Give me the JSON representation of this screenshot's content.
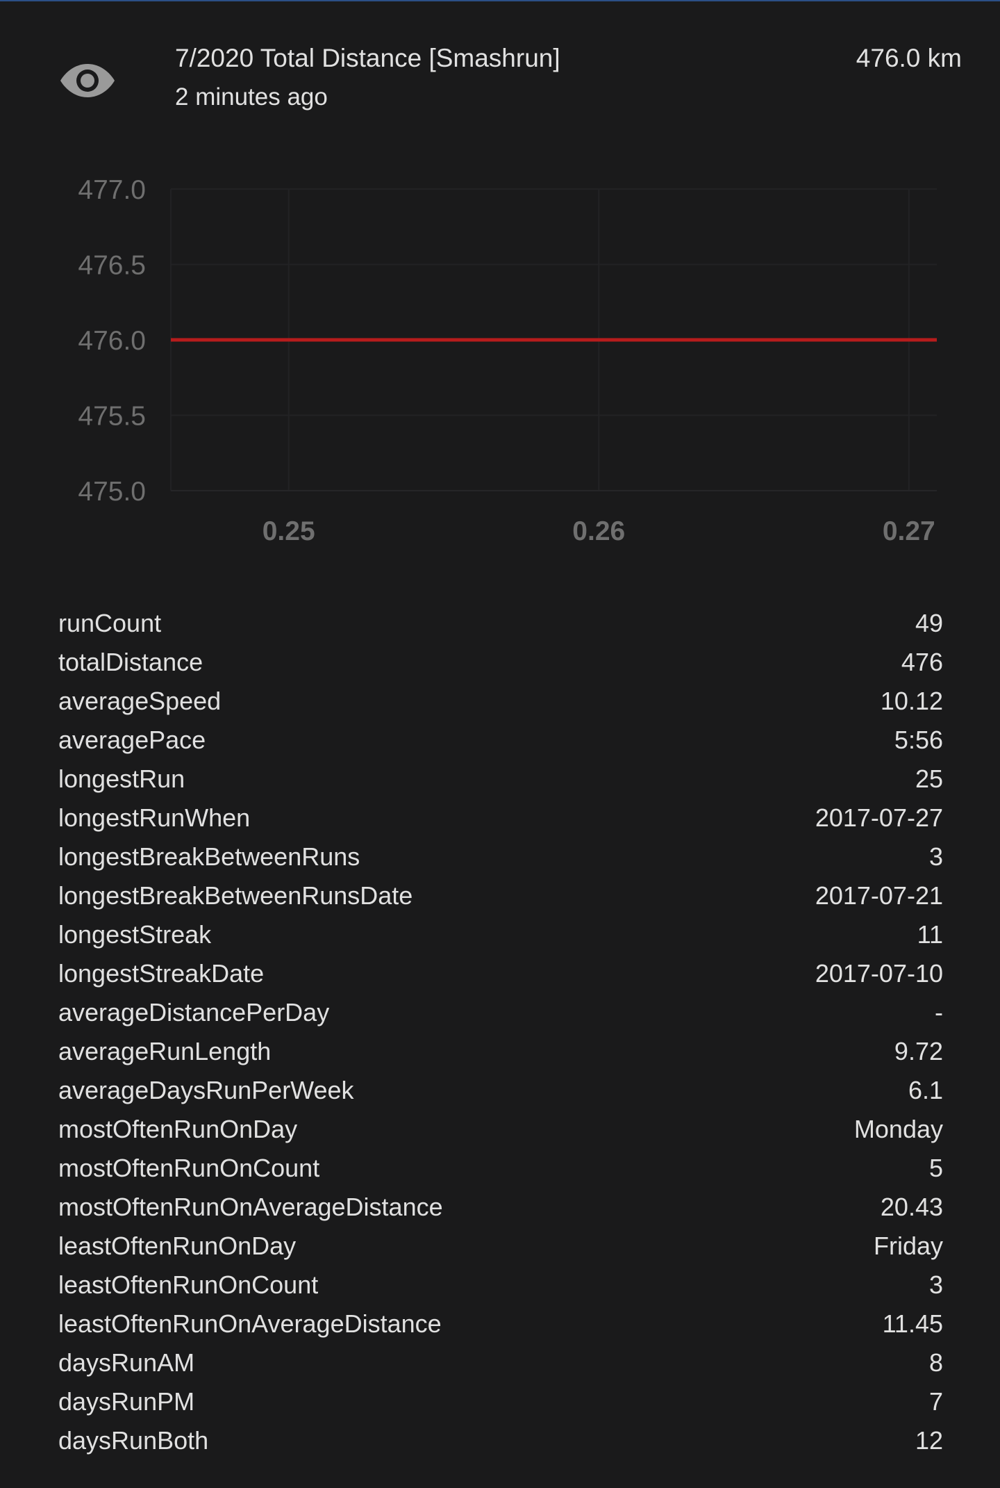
{
  "entity": {
    "icon": "eye-icon",
    "name": "7/2020 Total Distance [Smashrun]",
    "last_changed": "2 minutes ago",
    "state": "476.0 km"
  },
  "colors": {
    "background": "#1a1a1b",
    "line": "#b71c1c",
    "text": "#e1e1e1",
    "tick_text": "#6f6f6f"
  },
  "chart_data": {
    "type": "line",
    "title": "",
    "xlabel": "",
    "ylabel": "",
    "x_ticks": [
      "0.25",
      "0.26",
      "0.27"
    ],
    "y_ticks": [
      "477.0",
      "476.5",
      "476.0",
      "475.5",
      "475.0"
    ],
    "xlim": [
      0.2462,
      0.2709
    ],
    "ylim": [
      475.0,
      477.0
    ],
    "grid": true,
    "series": [
      {
        "x": [
          0.2462,
          0.2709
        ],
        "values": [
          476.0,
          476.0
        ]
      }
    ]
  },
  "attributes": [
    {
      "name": "runCount",
      "value": "49"
    },
    {
      "name": "totalDistance",
      "value": "476"
    },
    {
      "name": "averageSpeed",
      "value": "10.12"
    },
    {
      "name": "averagePace",
      "value": "5:56"
    },
    {
      "name": "longestRun",
      "value": "25"
    },
    {
      "name": "longestRunWhen",
      "value": "2017-07-27"
    },
    {
      "name": "longestBreakBetweenRuns",
      "value": "3"
    },
    {
      "name": "longestBreakBetweenRunsDate",
      "value": "2017-07-21"
    },
    {
      "name": "longestStreak",
      "value": "11"
    },
    {
      "name": "longestStreakDate",
      "value": "2017-07-10"
    },
    {
      "name": "averageDistancePerDay",
      "value": "-"
    },
    {
      "name": "averageRunLength",
      "value": "9.72"
    },
    {
      "name": "averageDaysRunPerWeek",
      "value": "6.1"
    },
    {
      "name": "mostOftenRunOnDay",
      "value": "Monday"
    },
    {
      "name": "mostOftenRunOnCount",
      "value": "5"
    },
    {
      "name": "mostOftenRunOnAverageDistance",
      "value": "20.43"
    },
    {
      "name": "leastOftenRunOnDay",
      "value": "Friday"
    },
    {
      "name": "leastOftenRunOnCount",
      "value": "3"
    },
    {
      "name": "leastOftenRunOnAverageDistance",
      "value": "11.45"
    },
    {
      "name": "daysRunAM",
      "value": "8"
    },
    {
      "name": "daysRunPM",
      "value": "7"
    },
    {
      "name": "daysRunBoth",
      "value": "12"
    }
  ]
}
